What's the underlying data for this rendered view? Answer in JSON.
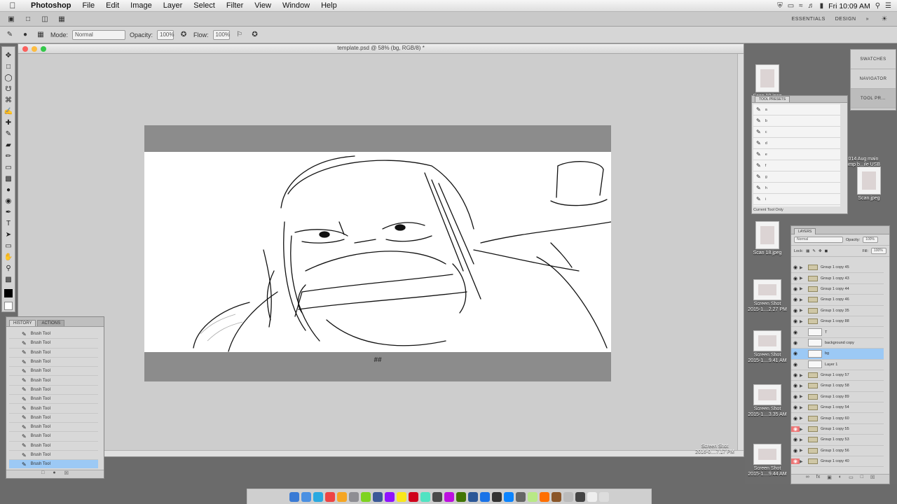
{
  "menubar": {
    "app_name": "Photoshop",
    "items": [
      "File",
      "Edit",
      "Image",
      "Layer",
      "Select",
      "Filter",
      "View",
      "Window",
      "Help"
    ],
    "clock": "Fri 10:09 AM"
  },
  "options_bar": {
    "mode_label": "Mode:",
    "mode_value": "Normal",
    "opacity_label": "Opacity:",
    "opacity_value": "100%",
    "flow_label": "Flow:",
    "flow_value": "100%"
  },
  "app_bar": {
    "workspace_essentials": "ESSENTIALS",
    "workspace_design": "DESIGN",
    "more": "»"
  },
  "document": {
    "title": "template.psd @ 58% (bg, RGB/8) *",
    "canvas_mark": "##"
  },
  "history_panel": {
    "tabs": [
      "HISTORY",
      "ACTIONS"
    ],
    "rows": [
      "Brush Tool",
      "Brush Tool",
      "Brush Tool",
      "Brush Tool",
      "Brush Tool",
      "Brush Tool",
      "Brush Tool",
      "Brush Tool",
      "Brush Tool",
      "Brush Tool",
      "Brush Tool",
      "Brush Tool",
      "Brush Tool",
      "Brush Tool",
      "Brush Tool"
    ],
    "active_index": 14
  },
  "presets_panel": {
    "title": "TOOL PRESETS",
    "rows": [
      "a",
      "b",
      "c",
      "d",
      "e",
      "f",
      "g",
      "h",
      "i"
    ],
    "footer": "Current Tool Only"
  },
  "dock_panels": {
    "items": [
      "SWATCHES",
      "NAVIGATOR",
      "TOOL PR..."
    ]
  },
  "desktop": {
    "files": [
      {
        "name": "Scan 19.jpeg"
      },
      {
        "name": "2014 Aug main\ncomp b...ile USB"
      },
      {
        "name": "Scan.jpeg"
      },
      {
        "name": "Scan 18.jpeg"
      },
      {
        "name": "Screen Shot\n2015-1....2.27 PM"
      },
      {
        "name": "Screen Shot\n2015-1....9.41 AM"
      },
      {
        "name": "Screen Shot\n2015-1....3.35 AM"
      },
      {
        "name": "Screen Shot\n2016-0....7.17 PM"
      },
      {
        "name": "Screen Shot\n2015-1....9.44 AM"
      }
    ]
  },
  "layers_panel": {
    "tab": "LAYERS",
    "kind_value": "Normal",
    "opacity_label": "Opacity:",
    "opacity_value": "100%",
    "lock_label": "Lock:",
    "fill_label": "Fill:",
    "fill_value": "100%",
    "rows": [
      {
        "label": "Group 1 copy 45"
      },
      {
        "label": "Group 1 copy 43"
      },
      {
        "label": "Group 1 copy 44"
      },
      {
        "label": "Group 1 copy 46"
      },
      {
        "label": "Group 1 copy 35"
      },
      {
        "label": "Group 1 copy 88"
      },
      {
        "label": "T"
      },
      {
        "label": "background copy"
      },
      {
        "label": "bg"
      },
      {
        "label": "Layer 1"
      },
      {
        "label": "Group 1 copy 57"
      },
      {
        "label": "Group 1 copy 58"
      },
      {
        "label": "Group 1 copy 89"
      },
      {
        "label": "Group 1 copy 54"
      },
      {
        "label": "Group 1 copy 60"
      },
      {
        "label": "Group 1 copy 55"
      },
      {
        "label": "Group 1 copy 53"
      },
      {
        "label": "Group 1 copy 56"
      },
      {
        "label": "Group 1 copy 40"
      }
    ],
    "active_index": 8
  },
  "colors": {
    "selection": "#9cc9f5",
    "canvas_bar": "#8c8c8c",
    "workspace": "#cdcdcd"
  }
}
